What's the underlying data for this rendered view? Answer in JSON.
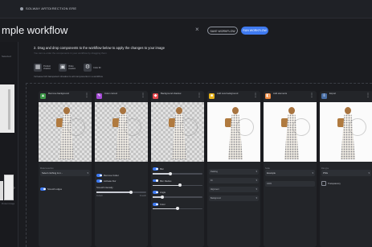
{
  "topbar": {
    "brand": "SOLWAY ARTDIRECTION ERE"
  },
  "header": {
    "title": "mple workflow",
    "close_glyph": "×",
    "btn_outline": "SAVE WORKFLOW",
    "btn_primary": "RUN WORKFLOW"
  },
  "sidebar": {
    "label": "Selected",
    "label2": "Product image"
  },
  "step": {
    "text": "2. Drag and drop components to the workflow below to apply the changes to your image",
    "hint": "You can re-order the components in your workflow by dragging them",
    "note": "Increase full transparent shadow to all components in a workflow"
  },
  "tools": [
    {
      "icon": "▦",
      "label": "Product shadow",
      "icon_name": "product-shadow-icon"
    },
    {
      "icon": "▣",
      "label": "Video creation",
      "icon_name": "video-icon"
    },
    {
      "icon": "⚙",
      "label": "Color fill",
      "icon_name": "settings-icon"
    }
  ],
  "cards": [
    {
      "name": "Remove background",
      "badge": "▲",
      "color": "#3f9a4a",
      "bg": "checker"
    },
    {
      "name": "Color correct",
      "badge": "✎",
      "color": "#a64bd6",
      "bg": "checker"
    },
    {
      "name": "Background shadow",
      "badge": "◆",
      "color": "#e5484d",
      "bg": "checker"
    },
    {
      "name": "Add new background",
      "badge": "■",
      "color": "#e7b31c",
      "bg": "white"
    },
    {
      "name": "Add elements",
      "badge": "◧",
      "color": "#f0883e",
      "bg": "white"
    },
    {
      "name": "Export",
      "badge": "⇩",
      "color": "#4a6fa5",
      "bg": "white"
    }
  ],
  "card1": {
    "lab": "Model selection",
    "sel": "Select clothing & m...",
    "toggle": "Smooth edges"
  },
  "card2": {
    "t1": "Remove Cutter",
    "t2": "Activate blur",
    "slider_label": "Smooth intensity",
    "slider_value": 0.7,
    "min": "Default",
    "max": "Smooth"
  },
  "card3": {
    "s1": "Blur",
    "s1_value": 0.35,
    "s2": "Blur Radius",
    "s2_value": 0.55,
    "s3": "Angle",
    "s3_value": 0.2,
    "s4": "Color",
    "s4_value": 0.5
  },
  "card4": {
    "f1": "Padding",
    "f2": "Fit",
    "f3": "Alignment",
    "f4": "Background"
  },
  "card5": {
    "lab": "Scale",
    "sel": "Example",
    "val": "100%"
  },
  "card6": {
    "lab": "File type",
    "sel": "PNG",
    "chk": "Transparency"
  }
}
